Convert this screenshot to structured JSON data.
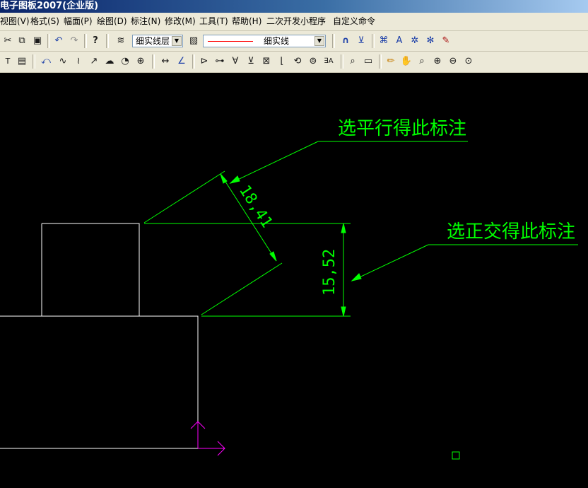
{
  "window": {
    "title": "电子图板2007(企业版)"
  },
  "menubar": {
    "items": [
      {
        "id": "view",
        "label": "视图(V)"
      },
      {
        "id": "format",
        "label": "格式(S)"
      },
      {
        "id": "sheet",
        "label": "幅面(P)"
      },
      {
        "id": "draw",
        "label": "绘图(D)"
      },
      {
        "id": "dimension",
        "label": "标注(N)"
      },
      {
        "id": "modify",
        "label": "修改(M)"
      },
      {
        "id": "tools",
        "label": "工具(T)"
      },
      {
        "id": "help",
        "label": "帮助(H)"
      },
      {
        "id": "dev",
        "label": "二次开发小程序"
      },
      {
        "id": "custom",
        "label": "自定义命令"
      }
    ]
  },
  "toolbar1": {
    "layer_combo": {
      "value": "细实线层"
    },
    "linetype_combo": {
      "value": "细实线"
    },
    "colors": {
      "linetype_sample": "#ff0000"
    }
  },
  "toolbar2": {},
  "drawing": {
    "colors": {
      "background": "#000000",
      "geometry": "#ffffff",
      "dimension": "#00ff00",
      "annotation": "#00ff00",
      "ucs": "#ff00ff",
      "marker": "#00ff00"
    },
    "dim_aligned": {
      "text": "18,41"
    },
    "dim_vertical": {
      "text": "15,52"
    },
    "note_parallel": {
      "text": "选平行得此标注"
    },
    "note_orthogonal": {
      "text": "选正交得此标注"
    }
  }
}
